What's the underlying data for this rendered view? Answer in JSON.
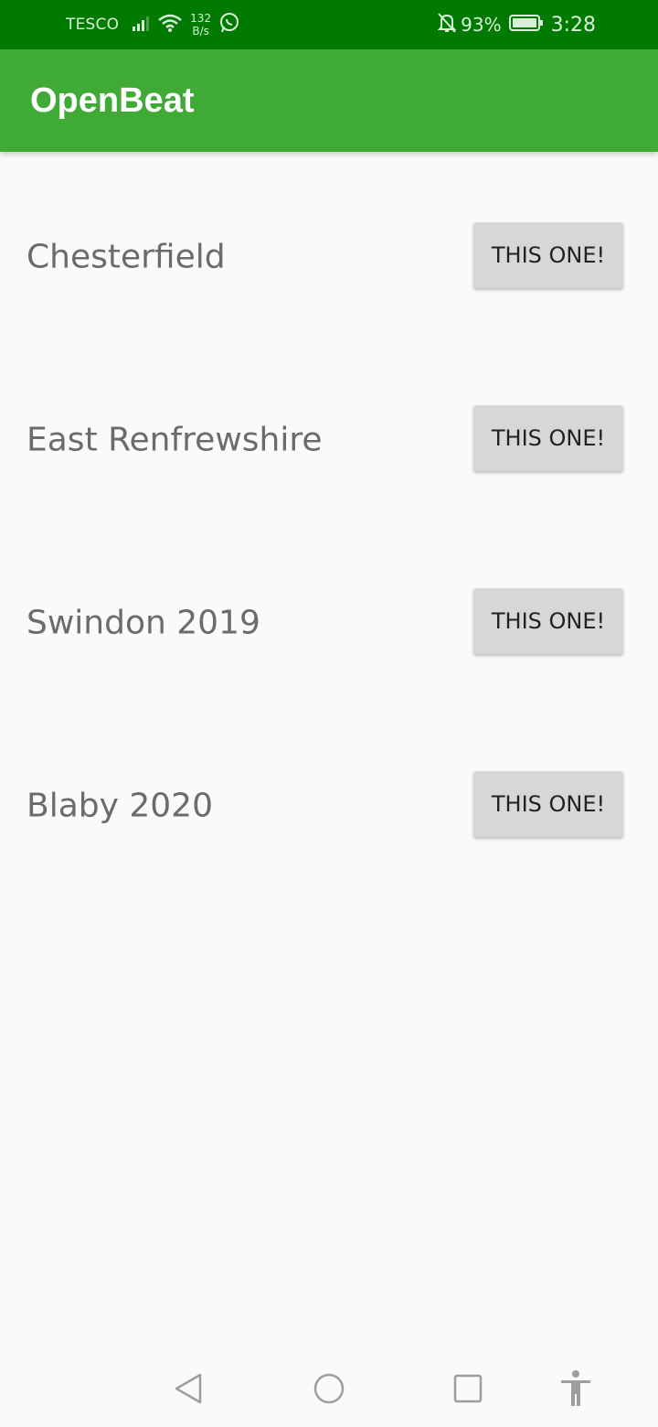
{
  "status_bar": {
    "carrier": "TESCO",
    "speed_value": "132",
    "speed_unit": "B/s",
    "battery_percent": "93%",
    "time": "3:28",
    "icons": [
      "signal-icon",
      "wifi-icon",
      "whatsapp-icon",
      "bell-off-icon",
      "battery-icon"
    ]
  },
  "app_bar": {
    "title": "OpenBeat",
    "color": "#3faa35"
  },
  "list": {
    "items": [
      {
        "label": "Chesterfield",
        "button": "THIS ONE!"
      },
      {
        "label": "East Renfrewshire",
        "button": "THIS ONE!"
      },
      {
        "label": "Swindon 2019",
        "button": "THIS ONE!"
      },
      {
        "label": "Blaby 2020",
        "button": "THIS ONE!"
      }
    ]
  },
  "nav_bar": {
    "icons": [
      "back-icon",
      "home-icon",
      "recents-icon",
      "accessibility-icon"
    ]
  },
  "colors": {
    "status_bar": "#007a00",
    "app_bar": "#3faa35",
    "background": "#fafafa",
    "button": "#d6d7d7"
  }
}
